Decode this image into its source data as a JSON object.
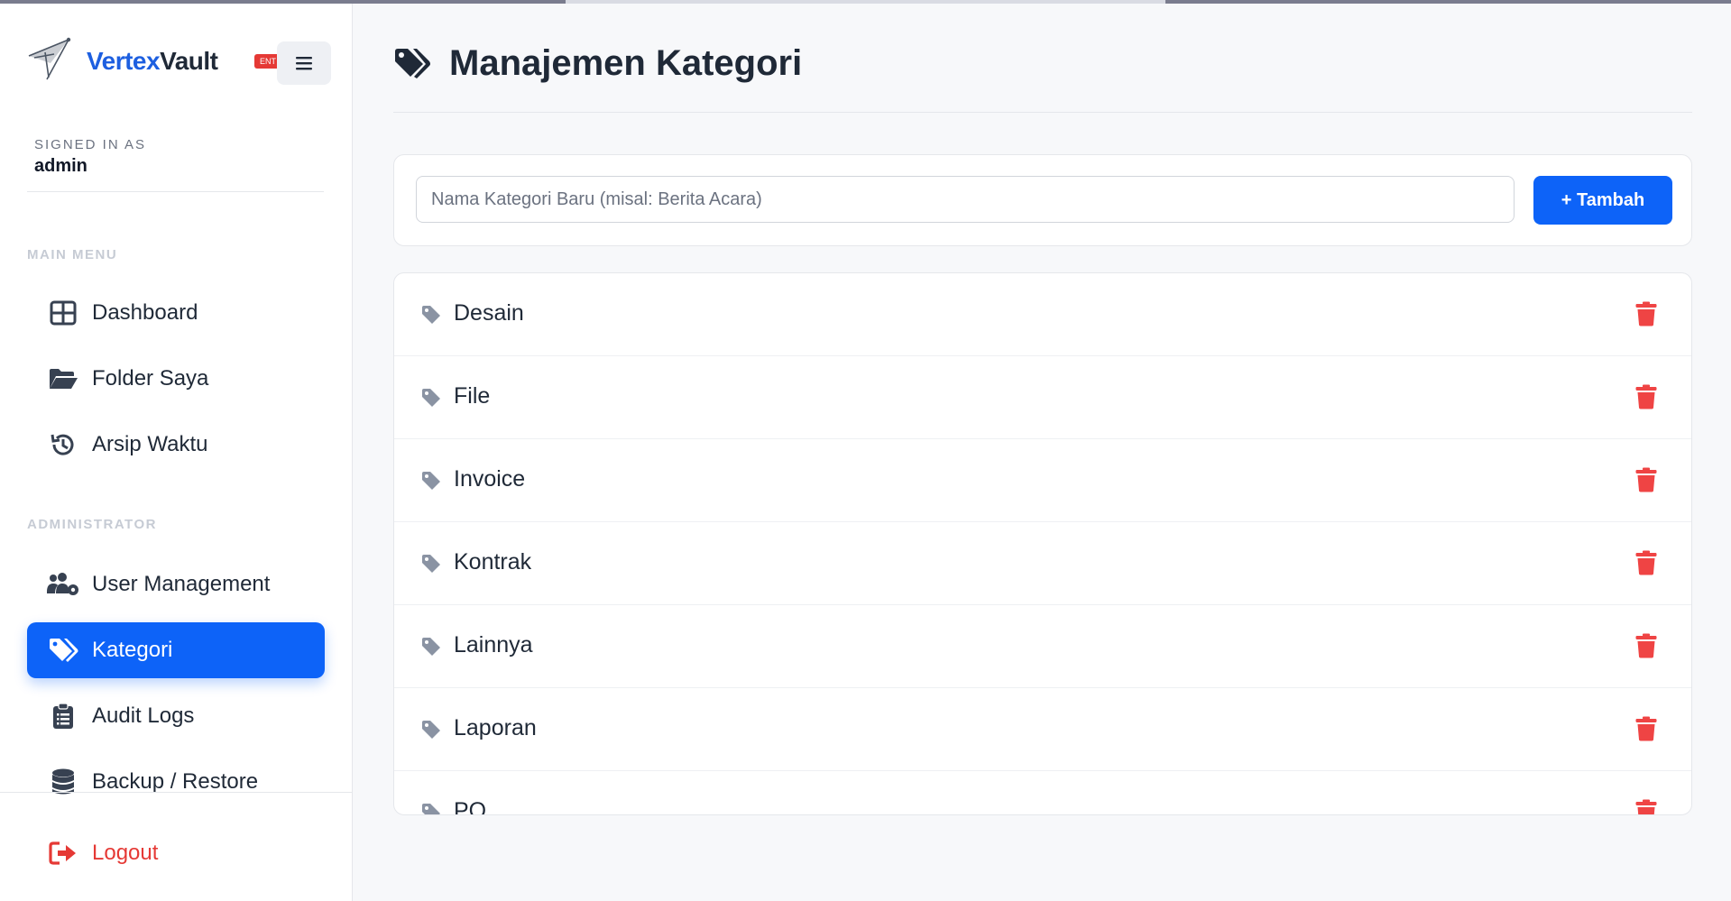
{
  "brand": {
    "name_part1": "Vertex",
    "name_part2": "Vault",
    "badge": "ENT"
  },
  "session": {
    "signed_in_label": "SIGNED IN AS",
    "username": "admin"
  },
  "sidebar": {
    "main_menu_title": "MAIN MENU",
    "main_items": [
      {
        "label": "Dashboard",
        "icon": "dashboard-grid-icon"
      },
      {
        "label": "Folder Saya",
        "icon": "folder-open-icon"
      },
      {
        "label": "Arsip Waktu",
        "icon": "history-icon"
      }
    ],
    "admin_title": "ADMINISTRATOR",
    "admin_items": [
      {
        "label": "User Management",
        "icon": "users-gear-icon"
      },
      {
        "label": "Kategori",
        "icon": "tags-icon",
        "active": true
      },
      {
        "label": "Audit Logs",
        "icon": "clipboard-list-icon"
      },
      {
        "label": "Backup / Restore",
        "icon": "database-icon"
      }
    ],
    "logout_label": "Logout"
  },
  "page": {
    "title": "Manajemen Kategori"
  },
  "add_form": {
    "placeholder": "Nama Kategori Baru (misal: Berita Acara)",
    "value": "",
    "button_label": "+ Tambah"
  },
  "categories": [
    "Desain",
    "File",
    "Invoice",
    "Kontrak",
    "Lainnya",
    "Laporan",
    "PO"
  ],
  "colors": {
    "accent": "#0d63f8",
    "danger": "#ef4444",
    "brand_blue": "#1d5fe0",
    "tag_gray": "#8a93a3"
  }
}
